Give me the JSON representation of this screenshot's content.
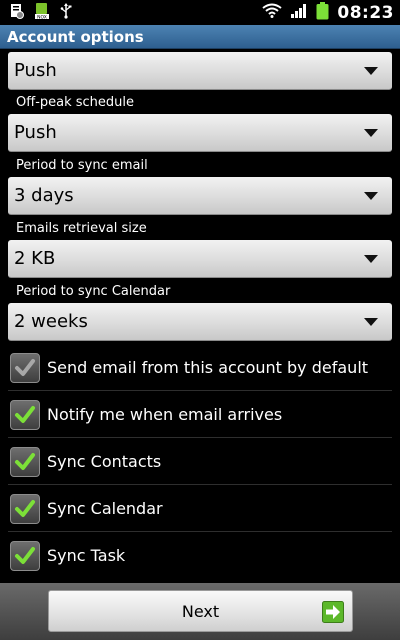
{
  "status_bar": {
    "time": "08:23",
    "icons": [
      "settings-notification-icon",
      "nox-icon",
      "usb-icon",
      "wifi-icon",
      "signal-icon",
      "battery-icon"
    ]
  },
  "title_bar": {
    "title": "Account options"
  },
  "spinners": {
    "peak": {
      "value": "Push"
    },
    "offpeak": {
      "label": "Off-peak schedule",
      "value": "Push"
    },
    "period_email": {
      "label": "Period to sync email",
      "value": "3 days"
    },
    "retrieval_size": {
      "label": "Emails retrieval size",
      "value": "2 KB"
    },
    "period_calendar": {
      "label": "Period to sync Calendar",
      "value": "2 weeks"
    }
  },
  "checkboxes": [
    {
      "label": "Send email from this account by default",
      "checked": true,
      "enabled": false
    },
    {
      "label": "Notify me when email arrives",
      "checked": true,
      "enabled": true
    },
    {
      "label": "Sync Contacts",
      "checked": true,
      "enabled": true
    },
    {
      "label": "Sync Calendar",
      "checked": true,
      "enabled": true
    },
    {
      "label": "Sync Task",
      "checked": true,
      "enabled": true
    }
  ],
  "bottom": {
    "next_label": "Next"
  },
  "colors": {
    "title_bar": "#3f73a3",
    "check_enabled": "#7ce038",
    "check_disabled": "#a8a8a8",
    "next_arrow": "#5cb82a"
  }
}
